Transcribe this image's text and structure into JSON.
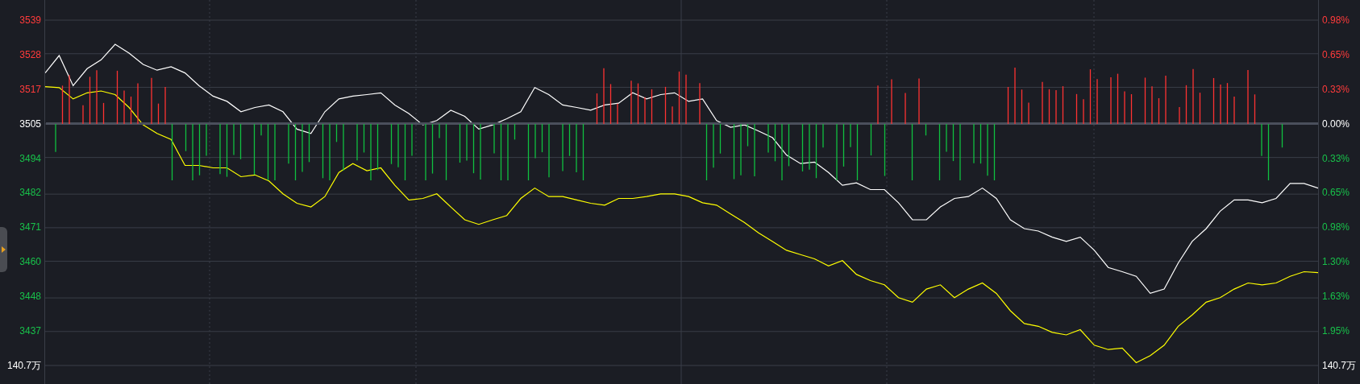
{
  "chart": {
    "chart_data": {
      "type": "line",
      "ylim": [
        3419.8,
        3545.6
      ],
      "grid": true,
      "yticks": [
        {
          "value": 3539,
          "label": "3539"
        },
        {
          "value": 3528,
          "label": "3528"
        },
        {
          "value": 3517,
          "label": "3517"
        },
        {
          "value": 3505,
          "label": "3505"
        },
        {
          "value": 3494,
          "label": "3494"
        },
        {
          "value": 3482,
          "label": "3482"
        },
        {
          "value": 3471,
          "label": "3471"
        },
        {
          "value": 3460,
          "label": "3460"
        },
        {
          "value": 3448,
          "label": "3448"
        },
        {
          "value": 3437,
          "label": "3437"
        }
      ],
      "series": [
        {
          "color": "#ffffff",
          "values": [
            3521.7,
            3527.4,
            3517.5,
            3523.1,
            3526,
            3531.1,
            3528.2,
            3524.5,
            3522.6,
            3523.7,
            3521.7,
            3517.5,
            3514.1,
            3512.4,
            3509,
            3510.4,
            3511.2,
            3509,
            3503.3,
            3501.9,
            3509,
            3513.2,
            3514.1,
            3514.6,
            3515.2,
            3511.2,
            3508.4,
            3504.7,
            3506.1,
            3509.5,
            3507.5,
            3503.3,
            3504.7,
            3506.7,
            3509,
            3516.9,
            3514.6,
            3511.2,
            3510.4,
            3509.5,
            3511.2,
            3511.8,
            3515.2,
            3513.2,
            3514.6,
            3515.2,
            3512.4,
            3513.2,
            3506.1,
            3503.9,
            3504.7,
            3502.7,
            3500.5,
            3494.8,
            3492,
            3492.5,
            3489.1,
            3484.9,
            3485.7,
            3483.5,
            3483.5,
            3479.2,
            3473.6,
            3473.6,
            3477.8,
            3480.6,
            3481.2,
            3484,
            3480.6,
            3473.6,
            3470.7,
            3469.9,
            3467.9,
            3466.5,
            3467.9,
            3463.6,
            3458,
            3456.6,
            3455.1,
            3449.5,
            3450.9,
            3459.4,
            3466.5,
            3470.7,
            3476.4,
            3480.1,
            3480.1,
            3479.2,
            3480.6,
            3485.5,
            3485.5,
            3484
          ]
        },
        {
          "color": "#ffff00",
          "values": [
            3517.2,
            3516.9,
            3513.2,
            3515.2,
            3515.8,
            3514.6,
            3510.4,
            3504.7,
            3501.9,
            3499.9,
            3491.4,
            3491.4,
            3490.6,
            3490.6,
            3487.7,
            3488.3,
            3486.3,
            3482.1,
            3479,
            3477.8,
            3481.2,
            3489.1,
            3492,
            3489.7,
            3490.6,
            3484.9,
            3480.1,
            3480.6,
            3482.1,
            3477.8,
            3473.6,
            3472.1,
            3473.6,
            3475,
            3480.6,
            3484,
            3481.2,
            3481.2,
            3480.1,
            3479,
            3478.4,
            3480.6,
            3480.6,
            3481.2,
            3482.1,
            3482.1,
            3481.2,
            3479.2,
            3478.4,
            3475.5,
            3472.7,
            3469.3,
            3466.5,
            3463.6,
            3462.2,
            3460.8,
            3458.5,
            3460.2,
            3455.7,
            3453.7,
            3452.3,
            3448.1,
            3446.6,
            3450.9,
            3452.3,
            3448.1,
            3450.9,
            3452.9,
            3449.5,
            3443.8,
            3439.6,
            3438.7,
            3436.7,
            3435.9,
            3437.6,
            3432.5,
            3431.1,
            3431.6,
            3426.8,
            3429.1,
            3432.5,
            3438.7,
            3442.4,
            3446.6,
            3448.1,
            3450.9,
            3452.9,
            3452.3,
            3452.9,
            3455.1,
            3456.6,
            3456.3
          ]
        }
      ]
    },
    "right_axis": [
      {
        "label": "0.98%",
        "kind": "up"
      },
      {
        "label": "0.65%",
        "kind": "up"
      },
      {
        "label": "0.33%",
        "kind": "up"
      },
      {
        "label": "0.00%",
        "kind": "flat"
      },
      {
        "label": "0.33%",
        "kind": "down"
      },
      {
        "label": "0.65%",
        "kind": "down"
      },
      {
        "label": "0.98%",
        "kind": "down"
      },
      {
        "label": "1.30%",
        "kind": "down"
      },
      {
        "label": "1.63%",
        "kind": "down"
      },
      {
        "label": "1.95%",
        "kind": "down"
      }
    ],
    "volume_left": "140.7万",
    "volume_right": "140.7万"
  }
}
